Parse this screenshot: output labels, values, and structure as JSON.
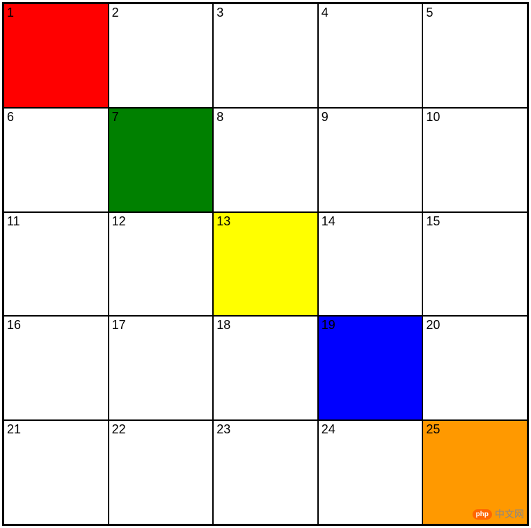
{
  "grid": {
    "rows": 5,
    "cols": 5,
    "cells": [
      {
        "label": "1",
        "color": "#ff0000"
      },
      {
        "label": "2",
        "color": ""
      },
      {
        "label": "3",
        "color": ""
      },
      {
        "label": "4",
        "color": ""
      },
      {
        "label": "5",
        "color": ""
      },
      {
        "label": "6",
        "color": ""
      },
      {
        "label": "7",
        "color": "#008000"
      },
      {
        "label": "8",
        "color": ""
      },
      {
        "label": "9",
        "color": ""
      },
      {
        "label": "10",
        "color": ""
      },
      {
        "label": "11",
        "color": ""
      },
      {
        "label": "12",
        "color": ""
      },
      {
        "label": "13",
        "color": "#ffff00"
      },
      {
        "label": "14",
        "color": ""
      },
      {
        "label": "15",
        "color": ""
      },
      {
        "label": "16",
        "color": ""
      },
      {
        "label": "17",
        "color": ""
      },
      {
        "label": "18",
        "color": ""
      },
      {
        "label": "19",
        "color": "#0000ff"
      },
      {
        "label": "20",
        "color": ""
      },
      {
        "label": "21",
        "color": ""
      },
      {
        "label": "22",
        "color": ""
      },
      {
        "label": "23",
        "color": ""
      },
      {
        "label": "24",
        "color": ""
      },
      {
        "label": "25",
        "color": "#ff9900"
      }
    ]
  },
  "watermark": {
    "logo_text": "php",
    "text": "中文网"
  }
}
